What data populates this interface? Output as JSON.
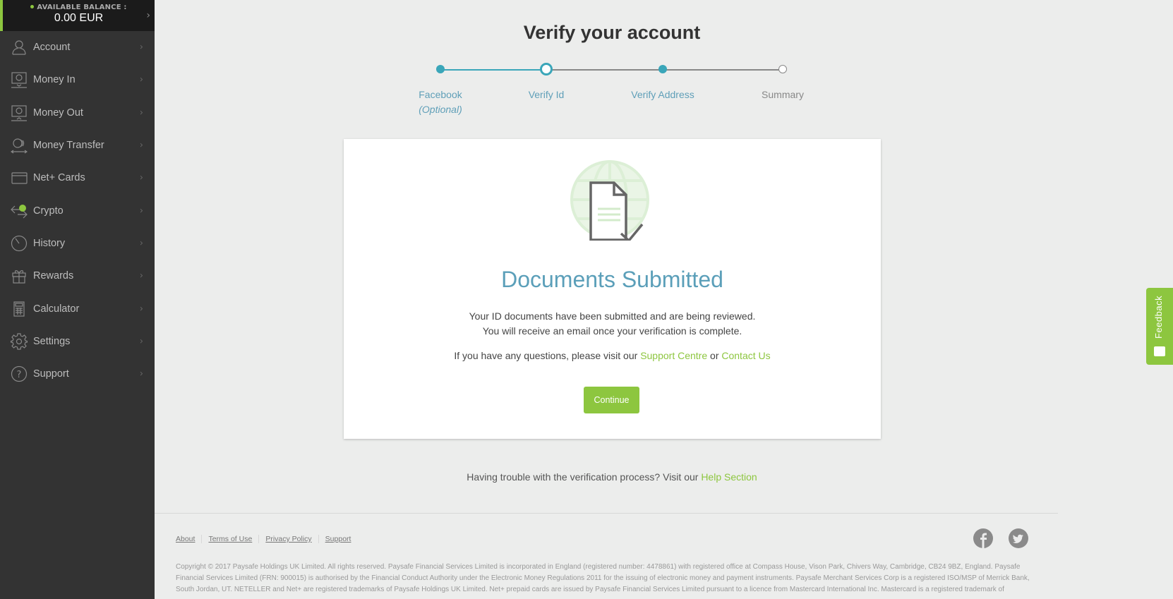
{
  "sidebar": {
    "balance_label": "AVAILABLE BALANCE :",
    "balance_amount": "0.00 EUR",
    "items": [
      {
        "label": "Account",
        "icon": "user-icon"
      },
      {
        "label": "Money In",
        "icon": "money-in-icon"
      },
      {
        "label": "Money Out",
        "icon": "money-out-icon"
      },
      {
        "label": "Money Transfer",
        "icon": "money-transfer-icon"
      },
      {
        "label": "Net+ Cards",
        "icon": "card-icon"
      },
      {
        "label": "Crypto",
        "icon": "crypto-icon"
      },
      {
        "label": "History",
        "icon": "history-icon"
      },
      {
        "label": "Rewards",
        "icon": "gift-icon"
      },
      {
        "label": "Calculator",
        "icon": "calculator-icon"
      },
      {
        "label": "Settings",
        "icon": "gear-icon"
      },
      {
        "label": "Support",
        "icon": "help-icon"
      }
    ]
  },
  "page": {
    "title": "Verify your account"
  },
  "stepper": {
    "steps": [
      {
        "label": "Facebook",
        "sublabel": "(Optional)",
        "state": "done"
      },
      {
        "label": "Verify Id",
        "state": "current"
      },
      {
        "label": "Verify Address",
        "state": "done"
      },
      {
        "label": "Summary",
        "state": "todo"
      }
    ]
  },
  "card": {
    "title": "Documents Submitted",
    "line1": "Your ID documents have been submitted and are being reviewed.",
    "line2": "You will receive an email once your verification is complete.",
    "help_prefix": "If you have any questions, please visit our ",
    "support_link": "Support Centre",
    "help_or": " or ",
    "contact_link": "Contact Us",
    "continue_label": "Continue"
  },
  "trouble": {
    "prefix": "Having trouble with the verification process? Visit our ",
    "link": "Help Section"
  },
  "footer": {
    "links": [
      "About",
      "Terms of Use",
      "Privacy Policy",
      "Support"
    ],
    "copyright": "Copyright © 2017 Paysafe Holdings UK Limited. All rights reserved. Paysafe Financial Services Limited is incorporated in England (registered number: 4478861) with registered office at Compass House, Vison Park, Chivers Way, Cambridge, CB24 9BZ, England. Paysafe Financial Services Limited (FRN: 900015) is authorised by the Financial Conduct Authority under the Electronic Money Regulations 2011 for the issuing of electronic money and payment instruments. Paysafe Merchant Services Corp is a registered ISO/MSP of Merrick Bank, South Jordan, UT. NETELLER and Net+ are registered trademarks of Paysafe Holdings UK Limited. Net+ prepaid cards are issued by Paysafe Financial Services Limited pursuant to a licence from Mastercard International Inc. Mastercard is a registered trademark of"
  },
  "feedback": {
    "label": "Feedback"
  },
  "colors": {
    "brand_green": "#8dc63f",
    "step_blue": "#3aa6b9",
    "title_blue": "#5b9fb9",
    "sidebar_bg": "#333333"
  }
}
